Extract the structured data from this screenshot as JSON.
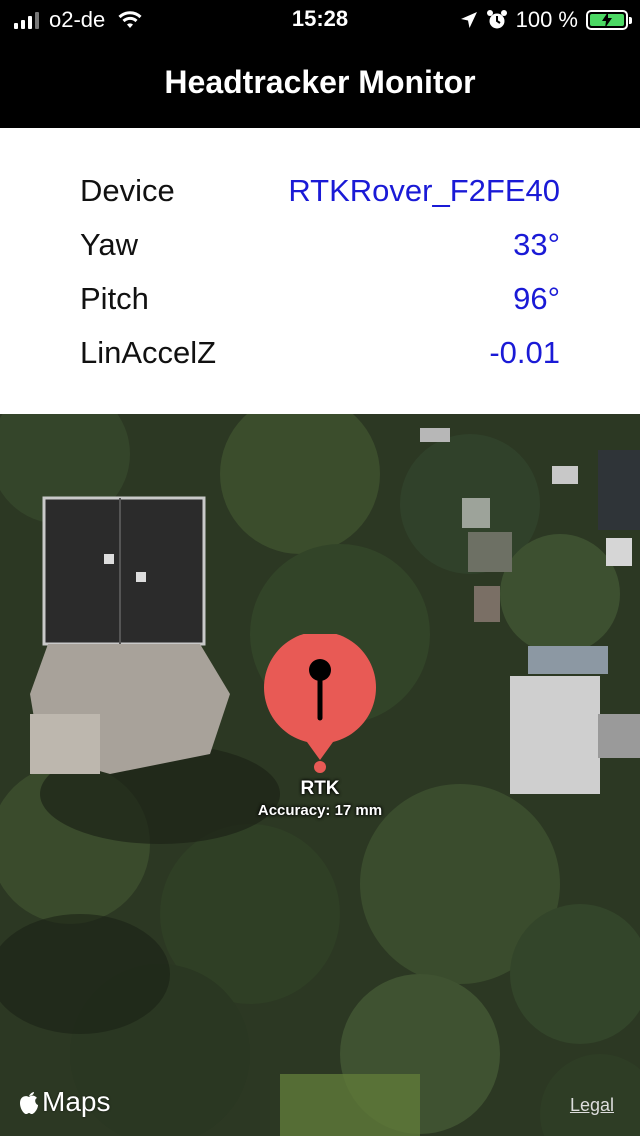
{
  "status_bar": {
    "carrier": "o2-de",
    "time": "15:28",
    "battery_percent": "100 %",
    "icons": [
      "cellular-signal-icon",
      "wifi-icon",
      "location-arrow-icon",
      "alarm-icon",
      "battery-charging-icon"
    ],
    "battery_color": "#4cd964"
  },
  "nav": {
    "title": "Headtracker Monitor"
  },
  "info": {
    "rows": [
      {
        "label": "Device",
        "value": "RTKRover_F2FE40"
      },
      {
        "label": "Yaw",
        "value": "33°"
      },
      {
        "label": "Pitch",
        "value": "96°"
      },
      {
        "label": "LinAccelZ",
        "value": "-0.01"
      }
    ],
    "value_color": "#1a1ad6"
  },
  "map": {
    "pin_title": "RTK",
    "pin_subtitle": "Accuracy: 17 mm",
    "pin_color": "#e85a55",
    "logo_text": "Maps",
    "legal_label": "Legal"
  }
}
